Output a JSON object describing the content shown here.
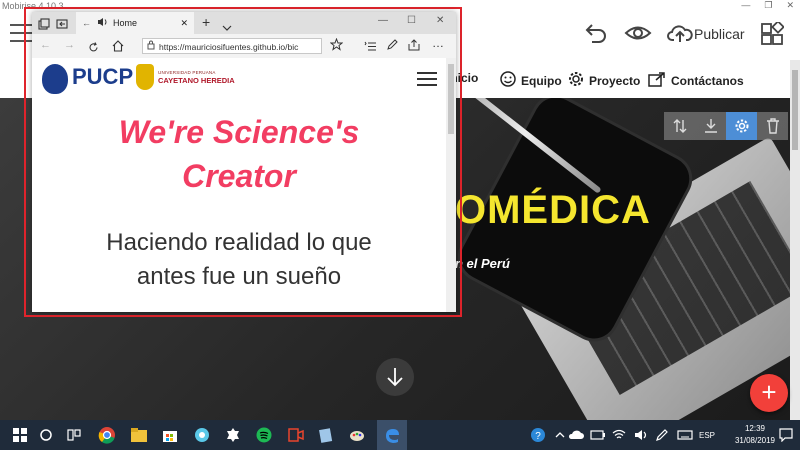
{
  "mobirise": {
    "title": "Mobirise 4.10.3",
    "publish_label": "Publicar",
    "icons": [
      "menu-icon",
      "undo-icon",
      "eye-icon",
      "cloud-upload-icon",
      "blocks-icon"
    ]
  },
  "site_nav": {
    "items": [
      {
        "label": "Inicio",
        "icon": "home-icon"
      },
      {
        "label": "Equipo",
        "icon": "smile-icon"
      },
      {
        "label": "Proyecto",
        "icon": "gear-icon"
      },
      {
        "label": "Contáctanos",
        "icon": "share-icon"
      }
    ]
  },
  "hero": {
    "title_fragment": "OMÉDICA",
    "subtitle_fragment": "n el Perú",
    "tools": [
      "sort-icon",
      "download-icon",
      "settings-icon",
      "trash-icon"
    ]
  },
  "edge": {
    "tab_title": "Home",
    "url": "https://mauriciosifuentes.github.io/bic",
    "pucp_text": "PUCP",
    "cayetano_small": "UNIVERSIDAD PERUANA",
    "cayetano_big": "CAYETANO HEREDIA",
    "headline_line1": "We're Science's",
    "headline_line2": "Creator",
    "subline_line1": "Haciendo realidad lo que",
    "subline_line2": "antes fue un sueño"
  },
  "taskbar": {
    "lang": "ESP",
    "time": "12:39",
    "date": "31/08/2019"
  },
  "colors": {
    "accent_red": "#f2403a",
    "hero_title": "#f5e62f",
    "headline_pink": "#f23d62",
    "highlight_frame": "#e0242c"
  }
}
